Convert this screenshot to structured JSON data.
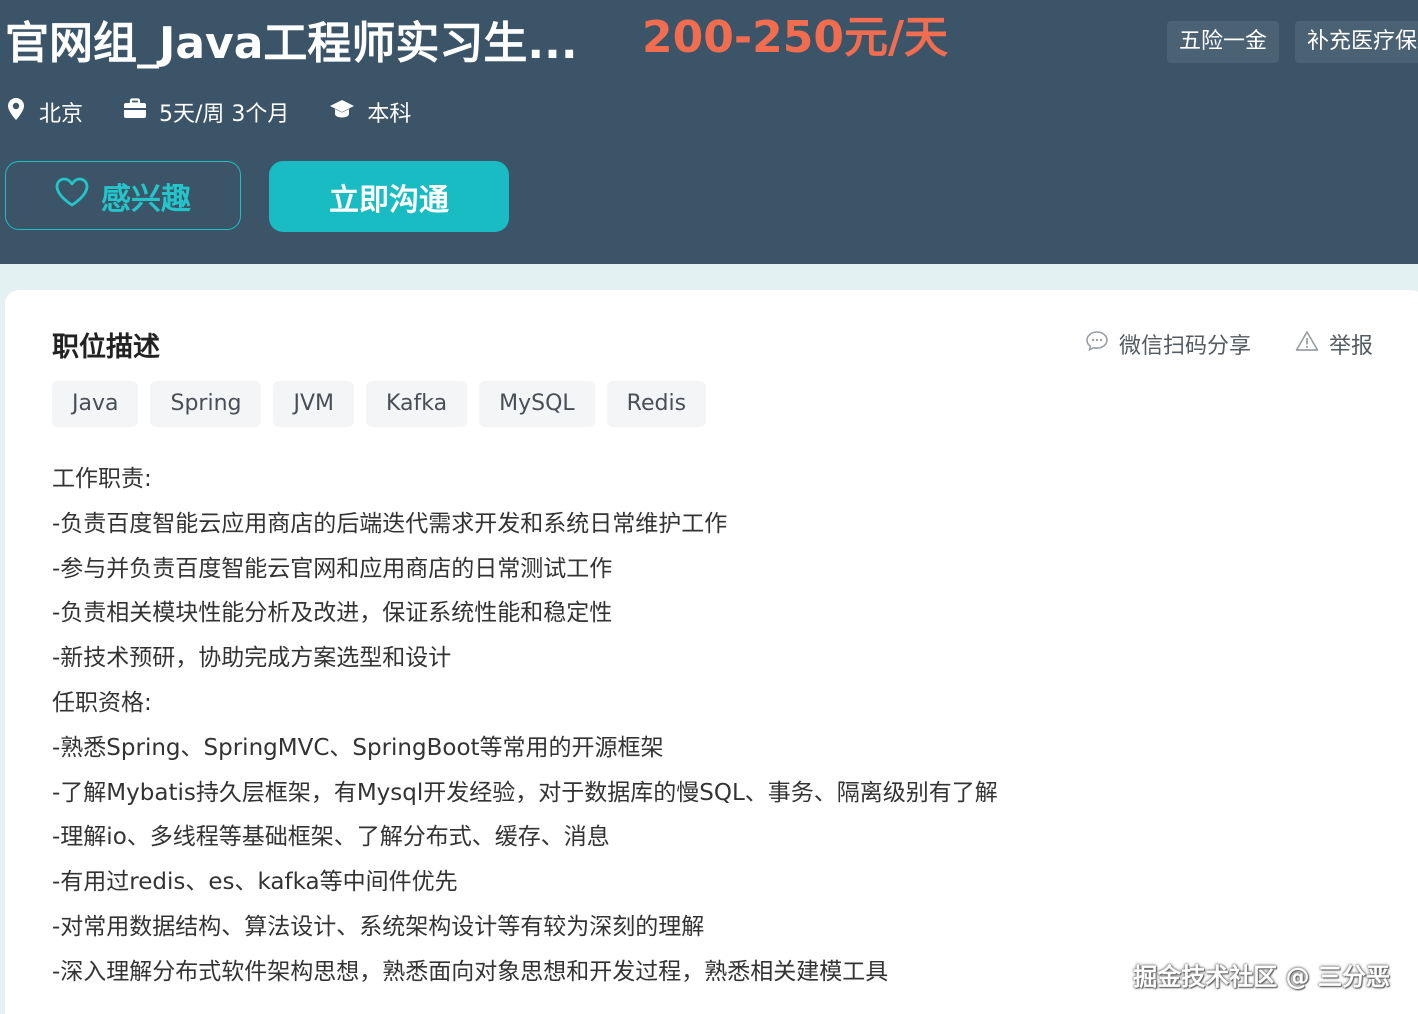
{
  "header": {
    "title": "官网组_Java工程师实习生...",
    "salary": "200-250元/天",
    "benefits": [
      "五险一金",
      "补充医疗保"
    ],
    "meta": {
      "location": "北京",
      "schedule": "5天/周 3个月",
      "education": "本科"
    },
    "buttons": {
      "interest": "感兴趣",
      "chat": "立即沟通"
    }
  },
  "description": {
    "title": "职位描述",
    "actions": {
      "share": "微信扫码分享",
      "report": "举报"
    },
    "skills": [
      "Java",
      "Spring",
      "JVM",
      "Kafka",
      "MySQL",
      "Redis"
    ],
    "lines": [
      "工作职责:",
      "-负责百度智能云应用商店的后端迭代需求开发和系统日常维护工作",
      "-参与并负责百度智能云官网和应用商店的日常测试工作",
      "-负责相关模块性能分析及改进，保证系统性能和稳定性",
      "-新技术预研，协助完成方案选型和设计",
      "任职资格:",
      "-熟悉Spring、SpringMVC、SpringBoot等常用的开源框架",
      "-了解Mybatis持久层框架，有Mysql开发经验，对于数据库的慢SQL、事务、隔离级别有了解",
      "-理解io、多线程等基础框架、了解分布式、缓存、消息",
      "-有用过redis、es、kafka等中间件优先",
      "-对常用数据结构、算法设计、系统架构设计等有较为深刻的理解",
      "-深入理解分布式软件架构思想，熟悉面向对象思想和开发过程，熟悉相关建模工具"
    ]
  },
  "watermark": "掘金技术社区 @ 三分恶",
  "colors": {
    "banner": "#3b5468",
    "salary": "#f26d4f",
    "accent": "#18bcc2"
  }
}
